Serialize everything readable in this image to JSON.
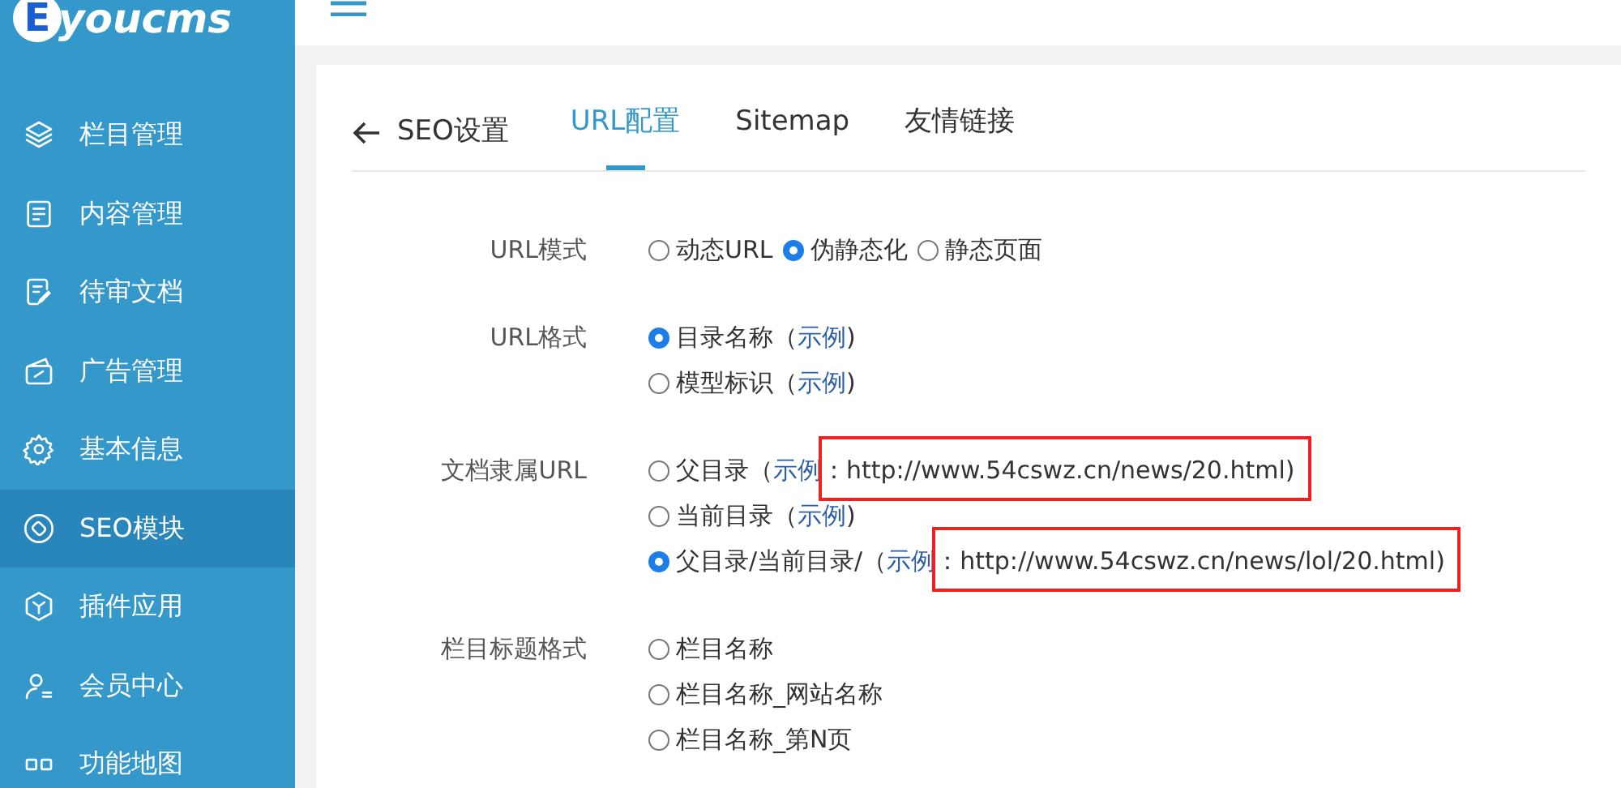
{
  "logo": {
    "letter": "E",
    "text": "youcms"
  },
  "sidebar": {
    "items": [
      {
        "label": "栏目管理",
        "selected": false
      },
      {
        "label": "内容管理",
        "selected": false
      },
      {
        "label": "待审文档",
        "selected": false
      },
      {
        "label": "广告管理",
        "selected": false
      },
      {
        "label": "基本信息",
        "selected": false
      },
      {
        "label": "SEO模块",
        "selected": true
      },
      {
        "label": "插件应用",
        "selected": false
      },
      {
        "label": "会员中心",
        "selected": false
      },
      {
        "label": "功能地图",
        "selected": false
      }
    ]
  },
  "back": {
    "label": "SEO设置"
  },
  "tabs": [
    {
      "label": "URL配置",
      "selected": true
    },
    {
      "label": "Sitemap",
      "selected": false
    },
    {
      "label": "友情链接",
      "selected": false
    }
  ],
  "fields": [
    {
      "label": "URL模式",
      "kind": "inline",
      "options": [
        {
          "label": "动态URL",
          "selected": false
        },
        {
          "label": "伪静态化",
          "selected": true
        },
        {
          "label": "静态页面",
          "selected": false
        }
      ]
    },
    {
      "label": "URL格式",
      "kind": "stack",
      "options": [
        {
          "label": "目录名称（",
          "link": "示例",
          "suffix": ")",
          "selected": true
        },
        {
          "label": "模型标识（",
          "link": "示例",
          "suffix": ")",
          "selected": false
        }
      ]
    },
    {
      "label": "文档隶属URL",
      "kind": "stack",
      "options": [
        {
          "label": "父目录（",
          "link": "示例",
          "suffix": "：http://www.54cswz.cn/news/20.html)",
          "selected": false,
          "highlighted": true
        },
        {
          "label": "当前目录（",
          "link": "示例",
          "suffix": ")",
          "selected": false
        },
        {
          "label": "父目录/当前目录/（",
          "link": "示例",
          "suffix": "：http://www.54cswz.cn/news/lol/20.html)",
          "selected": true,
          "highlighted": true
        }
      ]
    },
    {
      "label": "栏目标题格式",
      "kind": "stack",
      "options": [
        {
          "label": "栏目名称",
          "selected": false
        },
        {
          "label": "栏目名称_网站名称",
          "selected": false
        },
        {
          "label": "栏目名称_第N页",
          "selected": false
        }
      ]
    }
  ]
}
